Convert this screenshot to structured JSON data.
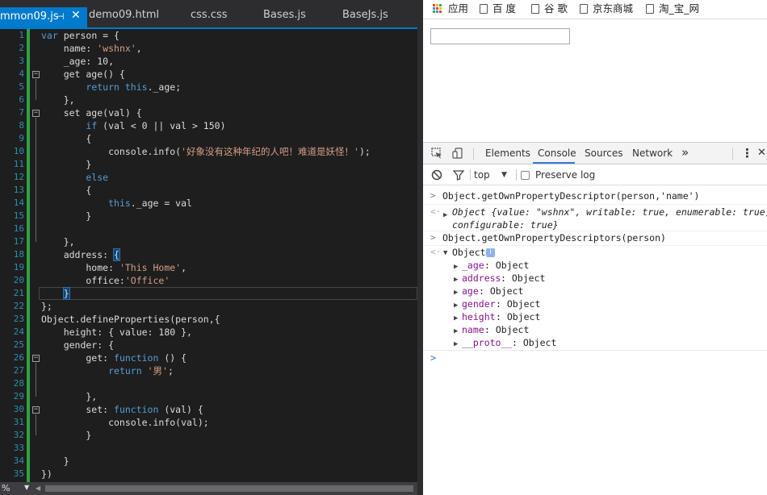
{
  "editor": {
    "tabs": [
      {
        "label": "mmon09.js",
        "active": true,
        "pin_icon": "pin-icon",
        "close_icon": "close-icon",
        "close_glyph": "✕",
        "pin_glyph": "⊣"
      },
      {
        "label": "demo09.html"
      },
      {
        "label": "css.css"
      },
      {
        "label": "Bases.js"
      },
      {
        "label": "BaseJs.js"
      }
    ],
    "line_numbers": [
      "1",
      "2",
      "3",
      "4",
      "5",
      "6",
      "7",
      "8",
      "9",
      "10",
      "11",
      "12",
      "13",
      "14",
      "15",
      "16",
      "17",
      "18",
      "19",
      "20",
      "21",
      "22",
      "23",
      "24",
      "25",
      "26",
      "27",
      "28",
      "29",
      "30",
      "31",
      "32",
      "33",
      "34",
      "35"
    ],
    "zoom": "%",
    "colors": {
      "background": "#1e1e1e",
      "keyword": "#569cd6",
      "string": "#d69d85",
      "text": "#dcdcdc",
      "line_number": "#2b91af",
      "changed_bar": "#2da343",
      "accent": "#007acc"
    }
  },
  "browser": {
    "bookmarks": [
      {
        "label": "应用",
        "icon": "apps-grid-icon"
      },
      {
        "label": "百 度",
        "icon": "page-icon"
      },
      {
        "label": "谷 歌",
        "icon": "page-icon"
      },
      {
        "label": "京东商城",
        "icon": "page-icon"
      },
      {
        "label": "淘_宝_网",
        "icon": "page-icon"
      }
    ],
    "input_value": ""
  },
  "devtools": {
    "tabs": [
      "Elements",
      "Console",
      "Sources",
      "Network"
    ],
    "active_tab": "Console",
    "more_glyph": "»",
    "menu_glyph": "⋮",
    "close_glyph": "✕",
    "context": "top",
    "preserve_log": "Preserve log",
    "console": {
      "cmd1": "Object.getOwnPropertyDescriptor(person,'name')",
      "result1_line1": "Object {value: \"wshnx\", writable: true, enumerable: true,",
      "result1_line2": "configurable: true}",
      "cmd2": "Object.getOwnPropertyDescriptors(person)",
      "result2_label": "Object",
      "info_badge": "i",
      "props": [
        {
          "key": "_age",
          "value": "Object"
        },
        {
          "key": "address",
          "value": "Object"
        },
        {
          "key": "age",
          "value": "Object"
        },
        {
          "key": "gender",
          "value": "Object"
        },
        {
          "key": "height",
          "value": "Object"
        },
        {
          "key": "name",
          "value": "Object"
        },
        {
          "key": "__proto__",
          "value": "Object"
        }
      ],
      "prompt": ">"
    }
  }
}
